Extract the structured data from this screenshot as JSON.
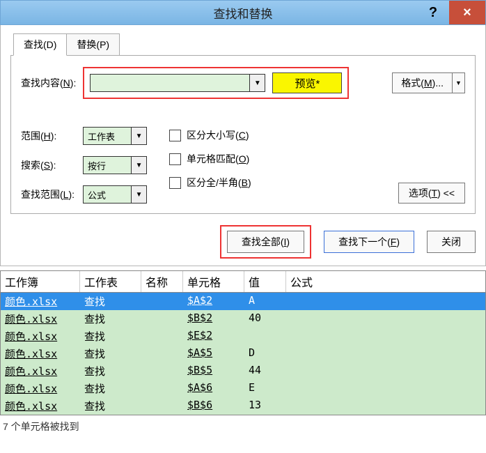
{
  "titlebar": {
    "title": "查找和替换",
    "help": "?",
    "close": "×"
  },
  "tabs": {
    "find": "查找(D)",
    "replace": "替换(P)"
  },
  "find": {
    "label_prefix": "查找内容(",
    "hotkey": "N",
    "label_suffix": "):",
    "value": "",
    "preview": "预览*",
    "format_prefix": "格式(",
    "format_hotkey": "M",
    "format_suffix": ")..."
  },
  "opts": {
    "scope": {
      "label_prefix": "范围(",
      "hotkey": "H",
      "label_suffix": "):",
      "value": "工作表"
    },
    "search": {
      "label_prefix": "搜索(",
      "hotkey": "S",
      "label_suffix": "):",
      "value": "按行"
    },
    "lookin": {
      "label_prefix": "查找范围(",
      "hotkey": "L",
      "label_suffix": "):",
      "value": "公式"
    },
    "case": {
      "label_prefix": "区分大小写(",
      "hotkey": "C",
      "label_suffix": ")"
    },
    "whole": {
      "label_prefix": "单元格匹配(",
      "hotkey": "O",
      "label_suffix": ")"
    },
    "width": {
      "label_prefix": "区分全/半角(",
      "hotkey": "B",
      "label_suffix": ")"
    },
    "options": {
      "label_prefix": "选项(",
      "hotkey": "T",
      "label_suffix": ") <<"
    }
  },
  "actions": {
    "find_all_prefix": "查找全部(",
    "find_all_hotkey": "I",
    "find_all_suffix": ")",
    "find_next_prefix": "查找下一个(",
    "find_next_hotkey": "F",
    "find_next_suffix": ")",
    "close": "关闭"
  },
  "results": {
    "columns": {
      "workbook": "工作簿",
      "sheet": "工作表",
      "name": "名称",
      "cell": "单元格",
      "value": "值",
      "formula": "公式"
    },
    "rows": [
      {
        "workbook": "颜色.xlsx",
        "sheet": "查找",
        "name": "",
        "cell": "$A$2",
        "value": "A",
        "formula": ""
      },
      {
        "workbook": "颜色.xlsx",
        "sheet": "查找",
        "name": "",
        "cell": "$B$2",
        "value": "40",
        "formula": ""
      },
      {
        "workbook": "颜色.xlsx",
        "sheet": "查找",
        "name": "",
        "cell": "$E$2",
        "value": "",
        "formula": ""
      },
      {
        "workbook": "颜色.xlsx",
        "sheet": "查找",
        "name": "",
        "cell": "$A$5",
        "value": "D",
        "formula": ""
      },
      {
        "workbook": "颜色.xlsx",
        "sheet": "查找",
        "name": "",
        "cell": "$B$5",
        "value": "44",
        "formula": ""
      },
      {
        "workbook": "颜色.xlsx",
        "sheet": "查找",
        "name": "",
        "cell": "$A$6",
        "value": "E",
        "formula": ""
      },
      {
        "workbook": "颜色.xlsx",
        "sheet": "查找",
        "name": "",
        "cell": "$B$6",
        "value": "13",
        "formula": ""
      }
    ]
  },
  "status": "7 个单元格被找到"
}
